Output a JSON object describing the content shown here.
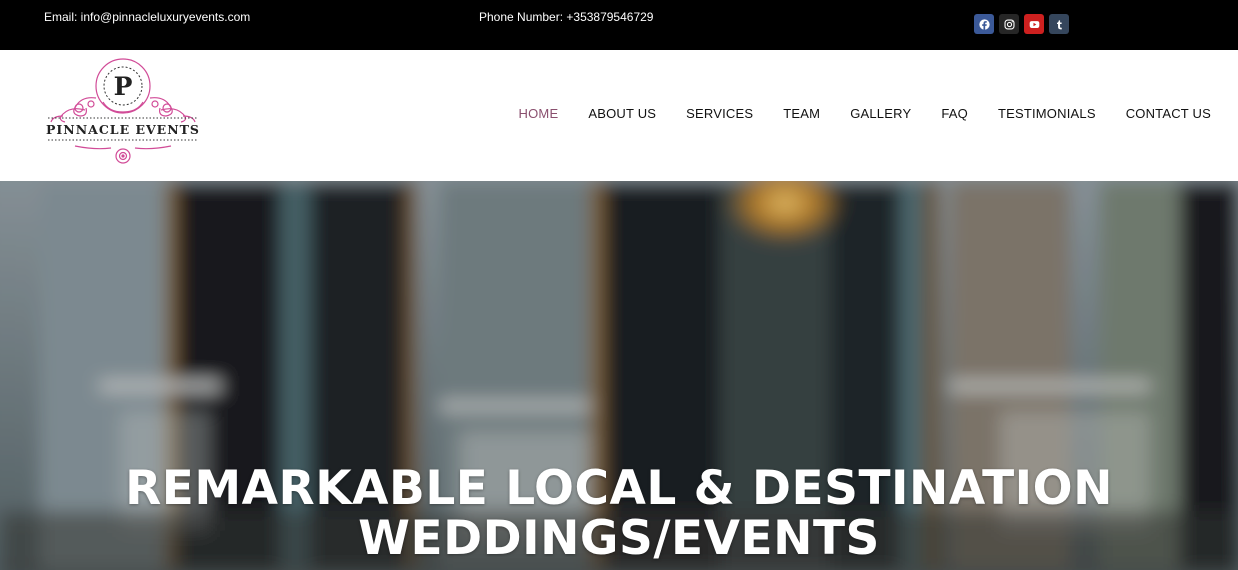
{
  "topbar": {
    "email": "Email: info@pinnacleluxuryevents.com",
    "phone": "Phone Number: +353879546729",
    "social": [
      {
        "name": "facebook-icon",
        "color": "#3b5998"
      },
      {
        "name": "instagram-icon",
        "color": "#262626"
      },
      {
        "name": "youtube-icon",
        "color": "#cd201f"
      },
      {
        "name": "tumblr-icon",
        "color": "#35465c"
      }
    ]
  },
  "logo": {
    "letter": "P",
    "text": "PINNACLE EVENTS",
    "accent": "#d14b97"
  },
  "nav": {
    "items": [
      {
        "label": "HOME",
        "active": true
      },
      {
        "label": "ABOUT US"
      },
      {
        "label": "SERVICES"
      },
      {
        "label": "TEAM"
      },
      {
        "label": "GALLERY"
      },
      {
        "label": "FAQ"
      },
      {
        "label": "TESTIMONIALS"
      },
      {
        "label": "CONTACT US"
      }
    ],
    "active_color": "#8a4f6e"
  },
  "hero": {
    "title_line1": "REMARKABLE LOCAL & DESTINATION",
    "title_line2": "WEDDINGS/EVENTS"
  }
}
